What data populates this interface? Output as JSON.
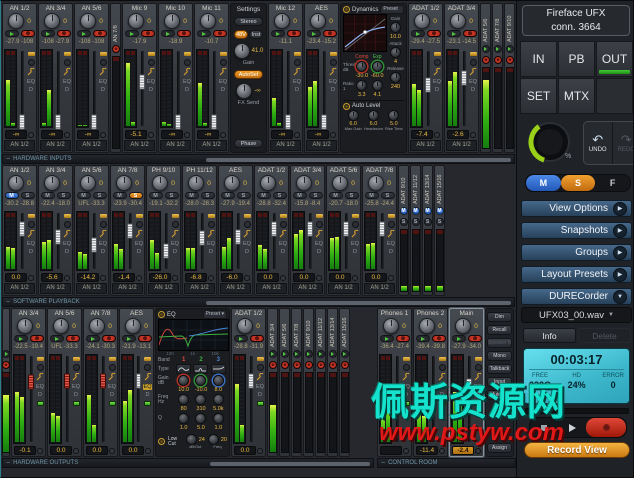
{
  "ui": {
    "m": "M",
    "s": "S",
    "eq": "EQ",
    "d": "D",
    "caret": "▼",
    "collapse": "−"
  },
  "sidebar": {
    "title_line1": "Fireface  UFX",
    "title_line2": "conn.  3664",
    "nav": [
      "IN",
      "PB",
      "OUT",
      "SET",
      "MTX"
    ],
    "undo": {
      "icon": "↶",
      "label": "UNDO"
    },
    "redo": {
      "icon": "↷",
      "label": "REDO"
    },
    "knob_percent": "%",
    "msf": [
      "M",
      "S",
      "F"
    ],
    "sections": [
      {
        "label": "View Options",
        "icon": "▶"
      },
      {
        "label": "Snapshots",
        "icon": "▶"
      },
      {
        "label": "Groups",
        "icon": "▶"
      },
      {
        "label": "Layout Presets",
        "icon": "▶"
      },
      {
        "label": "DURECorder",
        "icon": "▼"
      }
    ],
    "durec": {
      "file": "UFX03_00.wav",
      "info": "Info",
      "delete": "Delete",
      "time": "00:03:17",
      "free_label": "FREE",
      "free": "232G",
      "hd_label": "HD",
      "hd": "24%",
      "error_label": "ERROR",
      "error": "0",
      "record_view": "Record View"
    }
  },
  "bars": {
    "control_room": "CONTROL ROOM"
  },
  "rows": [
    {
      "label": "HARDWARE INPUTS",
      "items": [
        {
          "t": "f",
          "name": "AN 1/2",
          "pan": "0",
          "btn": "gr",
          "lvl": "-27.9 -108",
          "mL": 62,
          "mR": 4,
          "fp": 7,
          "cap": "w",
          "val": "-∞",
          "asn": "AN 1/2"
        },
        {
          "t": "f",
          "name": "AN 3/4",
          "pan": "0",
          "btn": "gr",
          "lvl": "-108 -27.9",
          "mL": 4,
          "mR": 48,
          "fp": 7,
          "cap": "w",
          "val": "-∞",
          "asn": "AN 1/2"
        },
        {
          "t": "f",
          "name": "AN 5/6",
          "pan": "0",
          "btn": "gr",
          "lvl": "-108 -108",
          "mL": 2,
          "mR": 2,
          "fp": 7,
          "cap": "w",
          "val": "-∞",
          "asn": "AN 1/2"
        },
        {
          "t": "m",
          "name": "AN 7/8",
          "sty": "r1a",
          "m": 0
        },
        {
          "t": "f",
          "name": "Mic 9",
          "pan": "0",
          "btn": "gr",
          "lvl": "-17.9",
          "mL": 84,
          "mR": 6,
          "fp": 58,
          "cap": "w",
          "val": "-5.1",
          "asn": "AN 1/2"
        },
        {
          "t": "f",
          "name": "Mic 10",
          "pan": "0",
          "btn": "gr",
          "lvl": "-18.9",
          "mL": 6,
          "mR": 3,
          "fp": 7,
          "cap": "w",
          "val": "-∞",
          "asn": "AN 1/2"
        },
        {
          "t": "f",
          "name": "Mic 11",
          "pan": "0",
          "btn": "gr",
          "lvl": "-10.7",
          "mL": 58,
          "mR": 4,
          "fp": 7,
          "cap": "w",
          "val": "-∞",
          "asn": "AN 1/2"
        },
        {
          "t": "p",
          "id": "p-settings"
        },
        {
          "t": "f",
          "name": "Mic 12",
          "pan": "0",
          "btn": "gr",
          "lvl": "-11.1",
          "mL": 38,
          "mR": 4,
          "fp": 7,
          "cap": "w",
          "val": "-∞",
          "asn": "AN 1/2"
        },
        {
          "t": "f",
          "name": "AES",
          "pan": "0",
          "btn": "gr",
          "lvl": "-23.4 -15.2",
          "mL": 52,
          "mR": 60,
          "fp": 7,
          "cap": "w",
          "val": "-∞",
          "asn": "AN 1/2"
        },
        {
          "t": "p",
          "id": "p-dyn"
        },
        {
          "t": "f",
          "name": "ADAT 1/2",
          "pan": "0",
          "btn": "gr",
          "lvl": "-29.4 -27.5",
          "mL": 56,
          "mR": 48,
          "fp": 54,
          "cap": "w",
          "val": "-7.4",
          "asn": "AN 1/2"
        },
        {
          "t": "f",
          "name": "ADAT 3/4",
          "pan": "0",
          "btn": "gr",
          "lvl": "-23.1 -14.5",
          "mL": 60,
          "mR": 72,
          "fp": 63,
          "cap": "w",
          "val": "-2.6",
          "asn": "AN 1/2"
        },
        {
          "t": "m",
          "name": "ADAT 5/6",
          "sty": "r1b",
          "m": 85
        },
        {
          "t": "m",
          "name": "ADAT 7/8",
          "sty": "r1b",
          "m": 0
        },
        {
          "t": "m",
          "name": "ADAT 9/10",
          "sty": "r1b",
          "m": 0
        }
      ]
    },
    {
      "label": "SOFTWARE PLAYBACK",
      "items": [
        {
          "t": "f",
          "name": "AN 1/2",
          "pan": "0",
          "btn": "ms",
          "m_on": true,
          "lvl": "-30.2 -28.8",
          "mL": 40,
          "mR": 38,
          "fp": 70,
          "cap": "w",
          "val": "0.0",
          "asn": "AN 1/2"
        },
        {
          "t": "f",
          "name": "AN 3/4",
          "pan": "0",
          "btn": "ms",
          "lvl": "-22.4 -18.0",
          "mL": 48,
          "mR": 52,
          "fp": 57,
          "cap": "w",
          "val": "-5.6",
          "asn": "AN 1/2"
        },
        {
          "t": "f",
          "name": "AN 5/6",
          "pan": "0",
          "btn": "ms",
          "lvl": "UFL  -33.3",
          "mL": 30,
          "mR": 26,
          "fp": 44,
          "cap": "w",
          "val": "-14.2",
          "asn": "AN 1/2"
        },
        {
          "t": "f",
          "name": "AN 7/8",
          "pan": "0",
          "btn": "ms",
          "s_on": true,
          "lvl": "-23.9 -30.4",
          "mL": 44,
          "mR": 36,
          "fp": 66,
          "cap": "w",
          "val": "-1.4",
          "asn": "AN 1/2"
        },
        {
          "t": "f",
          "name": "PH 9/10",
          "pan": "0",
          "btn": "ms",
          "lvl": "-19.1 -32.2",
          "mL": 52,
          "mR": 28,
          "fp": 33,
          "cap": "w",
          "val": "-26.0",
          "asn": "AN 1/2"
        },
        {
          "t": "f",
          "name": "PH 11/12",
          "pan": "0",
          "btn": "ms",
          "lvl": "-28.0 -28.3",
          "mL": 38,
          "mR": 37,
          "fp": 55,
          "cap": "w",
          "val": "-6.8",
          "asn": "AN 1/2"
        },
        {
          "t": "f",
          "name": "AES",
          "pan": "0",
          "btn": "ms",
          "lvl": "-27.9 -19.4",
          "mL": 40,
          "mR": 55,
          "fp": 56,
          "cap": "w",
          "val": "-6.0",
          "asn": "AN 1/2"
        },
        {
          "t": "f",
          "name": "ADAT 1/2",
          "pan": "0",
          "btn": "ms",
          "lvl": "-28.8 -32.4",
          "mL": 42,
          "mR": 35,
          "fp": 70,
          "cap": "w",
          "val": "0.0",
          "asn": "AN 1/2"
        },
        {
          "t": "f",
          "name": "ADAT 3/4",
          "pan": "0",
          "btn": "ms",
          "lvl": "-15.8 -8.4",
          "mL": 62,
          "mR": 70,
          "fp": 70,
          "cap": "w",
          "val": "0.0",
          "asn": "AN 1/2"
        },
        {
          "t": "f",
          "name": "ADAT 5/6",
          "pan": "0",
          "btn": "ms",
          "lvl": "-20.7 -18.0",
          "mL": 55,
          "mR": 58,
          "fp": 70,
          "cap": "w",
          "val": "0.0",
          "asn": "AN 1/2"
        },
        {
          "t": "f",
          "name": "ADAT 7/8",
          "pan": "0",
          "btn": "ms",
          "lvl": "-25.8 -24.4",
          "mL": 45,
          "mR": 47,
          "fp": 70,
          "cap": "w",
          "val": "0.0",
          "asn": "AN 1/2"
        },
        {
          "t": "m",
          "name": "ADAT 9/10",
          "sty": "r2",
          "m": 8
        },
        {
          "t": "m",
          "name": "ADAT 11/12",
          "sty": "r2",
          "m": 8
        },
        {
          "t": "m",
          "name": "ADAT 13/14",
          "sty": "r2",
          "m": 8
        },
        {
          "t": "m",
          "name": "ADAT 15/16",
          "sty": "r2",
          "m": 8
        }
      ]
    },
    {
      "label": "HARDWARE OUTPUTS",
      "items": [
        {
          "t": "m",
          "name": "",
          "sty": "r3",
          "m": 72,
          "w": 8
        },
        {
          "t": "f",
          "name": "AN 3/4",
          "pan": "0",
          "btn": "gr",
          "lvl": "-22.5 -19.4",
          "mL": 58,
          "mR": 52,
          "fp": 69,
          "cap": "r",
          "val": "-0.1"
        },
        {
          "t": "f",
          "name": "AN 5/6",
          "pan": "0",
          "btn": "gr",
          "lvl": "UFL  -33.3",
          "mL": 34,
          "mR": 30,
          "fp": 70,
          "cap": "r",
          "val": "0.0"
        },
        {
          "t": "f",
          "name": "AN 7/8",
          "pan": "0",
          "btn": "gr",
          "lvl": "-24.1 -30.3",
          "mL": 55,
          "mR": 20,
          "fp": 70,
          "cap": "r",
          "val": "0.0"
        },
        {
          "t": "f",
          "name": "AES",
          "pan": "0",
          "btn": "gr",
          "lvl": "-21.9 -13.1",
          "mL": 48,
          "mR": 60,
          "fp": 70,
          "cap": "w",
          "val": "0.0",
          "eq": true
        },
        {
          "t": "p",
          "id": "p-eq"
        },
        {
          "t": "f",
          "name": "ADAT 1/2",
          "pan": "0",
          "btn": "gr",
          "lvl": "-28.8 -31.9",
          "mL": 68,
          "mR": 20,
          "fp": 70,
          "cap": "w",
          "val": "0.0"
        },
        {
          "t": "m",
          "name": "ADAT 3/4",
          "sty": "r3",
          "m": 60
        },
        {
          "t": "m",
          "name": "ADAT 5/6",
          "sty": "r3",
          "m": 0
        },
        {
          "t": "m",
          "name": "ADAT 7/8",
          "sty": "r3",
          "m": 0
        },
        {
          "t": "m",
          "name": "ADAT 9/10",
          "sty": "r3",
          "m": 0
        },
        {
          "t": "m",
          "name": "ADAT 11/12",
          "sty": "r3",
          "m": 0
        },
        {
          "t": "m",
          "name": "ADAT 13/14",
          "sty": "r3",
          "m": 0
        },
        {
          "t": "m",
          "name": "ADAT 15/16",
          "sty": "r3",
          "m": 0
        },
        {
          "t": "g",
          "w": 26
        },
        {
          "t": "f",
          "name": "Phones 1",
          "pan": "0",
          "btn": "gr",
          "lvl": "-36.4 -27.4",
          "mL": 28,
          "mR": 40,
          "fp": 45,
          "cap": "w",
          "val": ""
        },
        {
          "t": "f",
          "name": "Phones 2",
          "pan": "0",
          "btn": "gr",
          "lvl": "-39.4 -39.8",
          "mL": 32,
          "mR": 30,
          "fp": 47,
          "cap": "w",
          "val": "-11.4"
        },
        {
          "t": "f",
          "name": "Main",
          "pan": "0",
          "btn": "gr",
          "lvl": "-27.9 -34.0",
          "mL": 58,
          "mR": 52,
          "fp": 65,
          "cap": "w",
          "val": "-2.4",
          "hl": true,
          "vhl": true
        },
        {
          "t": "p",
          "id": "p-cr"
        }
      ]
    }
  ],
  "panels": {
    "settings": {
      "title": "Settings",
      "stereo": "Stereo",
      "phantom": "48V",
      "inst": "Inst",
      "gain_value": "41.0",
      "gain_label": "Gain",
      "autoset": "AutoSet",
      "fx_value": "-∞",
      "fx_label": "FX Send",
      "phase": "Phase"
    },
    "dynamics": {
      "title": "Dynamics",
      "preset": "Preset",
      "gain_label": "Gain",
      "gain": "10.0",
      "attack_label": "Attack",
      "attack": "4",
      "release_label": "Release",
      "release": "240",
      "comp_label": "Comp",
      "comp": "-30.0",
      "exp_label": "Exp",
      "exp": "-60.0",
      "thresh_label": "Thresh. dB",
      "ratio_label": "Ratio 1",
      "ratio1": "3.3",
      "ratio2": "4.1",
      "auto_level": {
        "title": "Auto Level",
        "max_gain": "6.0",
        "max_gain_label": "Max Gain",
        "headroom": "6.0",
        "headroom_label": "Headroom",
        "rise_time": "5.0",
        "rise_time_label": "Rise Time"
      }
    },
    "eq": {
      "title": "EQ",
      "preset": "Preset",
      "axis": [
        "100",
        "1k",
        "10k"
      ],
      "band_label": "Band",
      "bands": [
        "1",
        "2",
        "3"
      ],
      "type_label": "Type",
      "gain_label": "Gain dB",
      "gains": [
        "10.0",
        "-10.0",
        "8.0"
      ],
      "freq_label": "Freq Hz",
      "freqs": [
        "80",
        "310",
        "5.0k"
      ],
      "q_label": "Q",
      "qs": [
        "1.0",
        "5.0",
        "1.0"
      ],
      "lowcut": {
        "label": "Low Cut",
        "slope": "24",
        "slope_label": "dB/Oct",
        "freq": "20",
        "freq_label": "Freq"
      }
    },
    "control_room": {
      "buttons": [
        {
          "label": "Dim"
        },
        {
          "label": "Recall"
        },
        {
          "label": "Speaker B"
        },
        {
          "label": "Mono"
        },
        {
          "label": "Talkback"
        },
        {
          "label": "Input"
        },
        {
          "label": "Mute FX"
        },
        {
          "label": "Assign"
        }
      ]
    }
  },
  "watermark": {
    "line1": "佩斯资源网",
    "line2": "www.pstyw.com"
  }
}
